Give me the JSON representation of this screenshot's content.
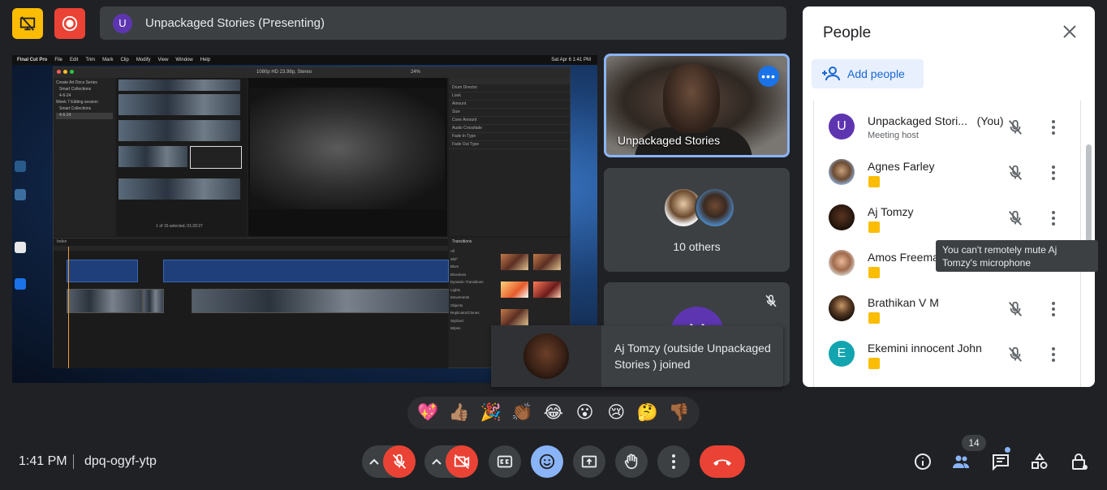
{
  "topbar": {
    "presenting_avatar_letter": "U",
    "presenting_label": "Unpackaged Stories (Presenting)",
    "buttons": [
      "stop-presenting-icon",
      "recording-icon"
    ],
    "colors": {
      "presentation_btn": "#fbbc04",
      "record_btn": "#ea4335"
    }
  },
  "shared_screen": {
    "menubar": [
      "Final Cut Pro",
      "File",
      "Edit",
      "Trim",
      "Mark",
      "Clip",
      "Modify",
      "View",
      "Window",
      "Help"
    ],
    "menubar_right": "Sat Apr 6  1:41 PM",
    "library": [
      "Create Art Docs Series",
      "Smart Collections",
      "4-6-24",
      "Week 7 Editing session",
      "Smart Collections",
      "4-6-24"
    ],
    "viewer_label": "1080p HD 23.98p, Stereo",
    "viewer_zoom": "24%",
    "browser_caption": "1 of 15 selected, 01:29:27",
    "inspector_rows": [
      "Drum Director",
      "Look",
      "Amount",
      "Size",
      "Cone Amount",
      "Audio Crossfade",
      "Fade In Type",
      "Fade Out Type"
    ],
    "transitions_title": "Transitions",
    "transitions_list": [
      "All",
      "360°",
      "Blurs",
      "Dissolves",
      "Dynamic Transitions",
      "Lights",
      "Movements",
      "Objects",
      "Replicator/Clones",
      "Stylized",
      "Wipes"
    ],
    "timeline_label": "Index"
  },
  "tiles": {
    "active_speaker": {
      "name": "Unpackaged Stories",
      "more_label": "•••"
    },
    "others": {
      "label": "10 others"
    },
    "third_tile_letter": "U"
  },
  "toast": {
    "text": "Aj Tomzy (outside Unpackaged Stories ) joined"
  },
  "people_panel": {
    "title": "People",
    "add_people": "Add people",
    "participants": [
      {
        "name": "Unpackaged Stori...",
        "suffix": "(You)",
        "subtitle": "Meeting host",
        "avatar_letter": "U",
        "avatar_color": "#5e35b1"
      },
      {
        "name": "Agnes Farley",
        "avatar_letter": ""
      },
      {
        "name": "Aj Tomzy",
        "avatar_letter": ""
      },
      {
        "name": "Amos Freema",
        "avatar_letter": ""
      },
      {
        "name": "Brathikan V M",
        "avatar_letter": ""
      },
      {
        "name": "Ekemini innocent John",
        "avatar_letter": "E",
        "avatar_color": "#12a4af"
      }
    ],
    "tooltip": "You can't remotely mute Aj Tomzy's microphone"
  },
  "reactions": [
    "💖",
    "👍🏽",
    "🎉",
    "👏🏾",
    "😂",
    "😮",
    "😢",
    "🤔",
    "👎🏾"
  ],
  "bottombar": {
    "time": "1:41 PM",
    "meeting_code": "dpq-ogyf-ytp",
    "participant_count": "14",
    "colors": {
      "danger": "#ea4335",
      "active": "#8ab4f8",
      "neutral": "#3c4043"
    }
  }
}
